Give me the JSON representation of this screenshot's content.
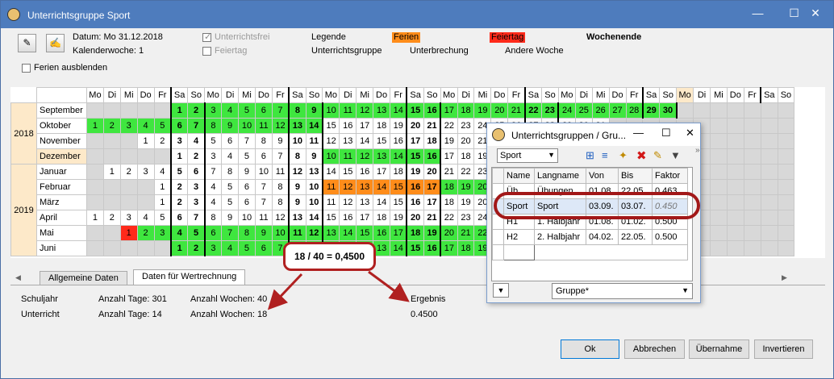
{
  "window": {
    "title": "Unterrichtsgruppe Sport"
  },
  "top": {
    "datum": "Datum: Mo 31.12.2018",
    "kw": "Kalenderwoche: 1",
    "unterrichtsfrei": "Unterrichtsfrei",
    "feiertag_chk": "Feiertag",
    "legende": "Legende",
    "ferien": "Ferien",
    "feiertag": "Feiertag",
    "wochenende": "Wochenende",
    "unterrichtsgruppe": "Unterrichtsgruppe",
    "unterbrechung": "Unterbrechung",
    "andere_woche": "Andere Woche",
    "ferien_ausblenden": "Ferien ausblenden"
  },
  "colors": {
    "green": "#3fe63f",
    "orange": "#ff8c1a",
    "red": "#ff2a1a",
    "title": "#4e7cbd"
  },
  "calendar": {
    "weekdays": [
      "Mo",
      "Di",
      "Mi",
      "Do",
      "Fr",
      "Sa",
      "So",
      "Mo",
      "Di",
      "Mi",
      "Do",
      "Fr",
      "Sa",
      "So",
      "Mo",
      "Di",
      "Mi",
      "Do",
      "Fr",
      "Sa",
      "So",
      "Mo",
      "Di",
      "Mi",
      "Do",
      "Fr",
      "Sa",
      "So",
      "Mo",
      "Di",
      "Mi",
      "Do",
      "Fr",
      "Sa",
      "So",
      "Mo",
      "Di",
      "Mi",
      "Do",
      "Fr",
      "Sa",
      "So"
    ],
    "years": [
      {
        "label": "2018",
        "rows": 4
      },
      {
        "label": "2019",
        "rows": 6
      }
    ],
    "months": [
      {
        "name": "September",
        "start": 5,
        "days": 30,
        "green": [
          1,
          30
        ],
        "orange": [],
        "red": []
      },
      {
        "name": "Oktober",
        "start": 0,
        "days": 31,
        "green": [
          1,
          14
        ],
        "orange": [],
        "red": []
      },
      {
        "name": "November",
        "start": 3,
        "days": 30,
        "green": [],
        "orange": [],
        "red": []
      },
      {
        "name": "Dezember",
        "start": 5,
        "days": 31,
        "green": [
          10,
          16
        ],
        "orange": [],
        "red": []
      },
      {
        "name": "Januar",
        "start": 1,
        "days": 31,
        "green": [],
        "orange": [],
        "red": []
      },
      {
        "name": "Februar",
        "start": 4,
        "days": 28,
        "green": [
          18,
          28
        ],
        "orange": [
          11,
          17
        ],
        "red": []
      },
      {
        "name": "März",
        "start": 4,
        "days": 31,
        "green": [],
        "orange": [],
        "red": []
      },
      {
        "name": "April",
        "start": 0,
        "days": 30,
        "green": [],
        "orange": [],
        "red": []
      },
      {
        "name": "Mai",
        "start": 2,
        "days": 31,
        "green": [
          2,
          31
        ],
        "orange": [],
        "red": [
          1
        ]
      },
      {
        "name": "Juni",
        "start": 5,
        "days": 30,
        "green": [
          1,
          30
        ],
        "orange": [],
        "red": []
      }
    ]
  },
  "tabs": [
    "Allgemeine Daten",
    "Daten für Wertrechnung"
  ],
  "panel": {
    "schuljahr": "Schuljahr",
    "unterricht": "Unterricht",
    "tage1": "Anzahl Tage: 301",
    "tage2": "Anzahl Tage: 14",
    "wochen1": "Anzahl Wochen: 40",
    "wochen2": "Anzahl Wochen: 18",
    "ergebnis": "Ergebnis",
    "ergebnis_val": "0.4500"
  },
  "callout": "18 / 40 = 0,4500",
  "buttons": {
    "ok": "Ok",
    "abbrechen": "Abbrechen",
    "uebernahme": "Übernahme",
    "invertieren": "Invertieren"
  },
  "sub": {
    "title": "Unterrichtsgruppen / Gru...",
    "combo": "Sport",
    "columns": [
      "Name",
      "Langname",
      "Von",
      "Bis",
      "Faktor"
    ],
    "rows": [
      [
        "Üb",
        "Übungen",
        "01.08.",
        "22.05.",
        "0.463"
      ],
      [
        "Sport",
        "Sport",
        "03.09.",
        "03.07.",
        "0.450"
      ],
      [
        "H1",
        "1. Halbjahr",
        "01.08.",
        "01.02.",
        "0.500"
      ],
      [
        "H2",
        "2. Halbjahr",
        "04.02.",
        "22.05.",
        "0.500"
      ]
    ],
    "bottom_combo": "Gruppe*"
  }
}
